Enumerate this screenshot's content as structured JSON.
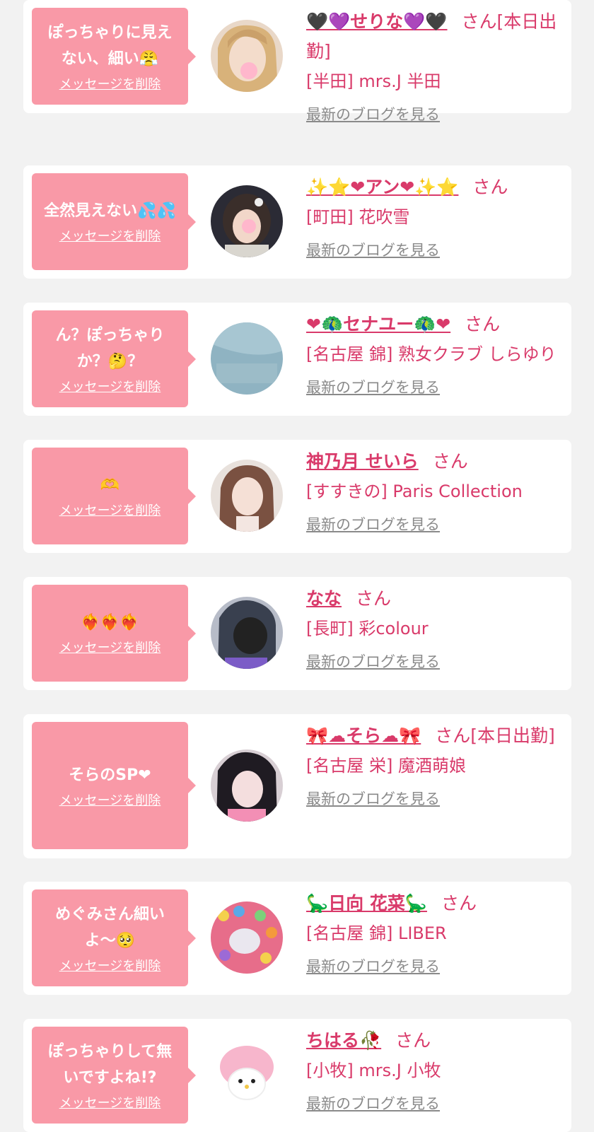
{
  "delete_label": "メッセージを削除",
  "san_label": "さん",
  "blog_label": "最新のブログを見る",
  "colors": {
    "background": "#f2f2f2",
    "bubble": "#f999a7",
    "accent_pink": "#d93a6a",
    "link_gray": "#8a8a8a"
  },
  "cards": [
    {
      "message": "ぽっちゃりに見えない、細い😤",
      "girl_name": "🖤💜せりな💜🖤",
      "suffix": "さん[本日出勤]",
      "shop": "[半田] mrs.J 半田",
      "avatar": "blonde-woman-photo"
    },
    {
      "message": "全然見えない💦💦",
      "girl_name": "✨⭐❤アン❤✨⭐",
      "suffix": "さん",
      "shop": "[町田] 花吹雪",
      "avatar": "dark-hair-woman-photo"
    },
    {
      "message": "ん？ぽっちゃりか？🤔？",
      "girl_name": "❤🦚セナユー🦚❤",
      "suffix": "さん",
      "shop": "[名古屋 錦] 熟女クラブ しらゆり",
      "avatar": "no-photo-placeholder"
    },
    {
      "message": "🫶",
      "girl_name": "神乃月 せいら",
      "suffix": "さん",
      "shop": "[すすきの] Paris Collection",
      "avatar": "brown-hair-woman-photo"
    },
    {
      "message": "❤‍🔥❤‍🔥❤‍🔥",
      "girl_name": "なな",
      "suffix": "さん",
      "shop": "[長町] 彩colour",
      "avatar": "scribbled-face-photo"
    },
    {
      "message": "そらのSP❤",
      "girl_name": "🎀☁そら☁🎀",
      "suffix": "さん[本日出勤]",
      "shop": "[名古屋 栄] 魔酒萌娘",
      "avatar": "bangs-woman-photo"
    },
    {
      "message": "めぐみさん細いよ〜🥺",
      "girl_name": "🦕日向 花菜🦕",
      "suffix": "さん",
      "shop": "[名古屋 錦] LIBER",
      "avatar": "ball-pit-photo"
    },
    {
      "message": "ぽっちゃりして無いですよね!?",
      "girl_name": "ちはる🥀",
      "suffix": "さん",
      "shop": "[小牧] mrs.J 小牧",
      "avatar": "pink-plush-photo"
    }
  ]
}
